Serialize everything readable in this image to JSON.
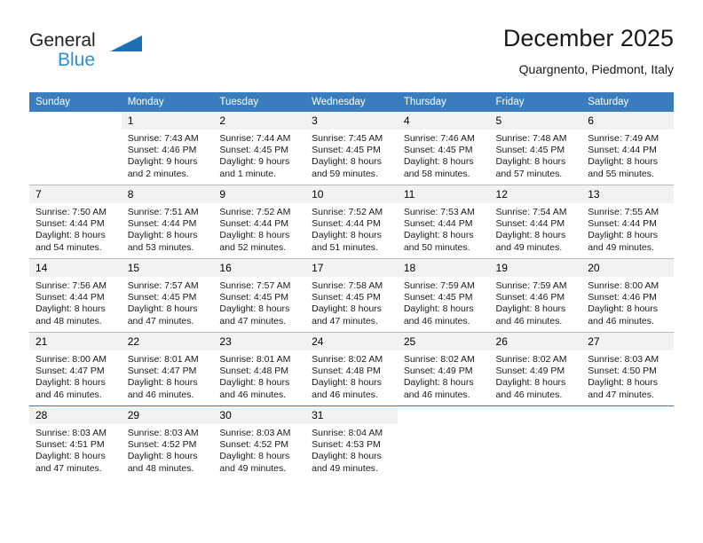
{
  "brand": {
    "name_part1": "General",
    "name_part2": "Blue",
    "colors": {
      "dark": "#231f20",
      "blue": "#2b8fd4",
      "triangle": "#1f6fb4"
    }
  },
  "header": {
    "title": "December 2025",
    "subtitle": "Quargnento, Piedmont, Italy"
  },
  "theme": {
    "header_row_bg": "#3a7dbf",
    "header_row_text": "#ffffff",
    "daynum_bg": "#f2f2f2",
    "grid_line": "#b9b9b9"
  },
  "weekdays": [
    "Sunday",
    "Monday",
    "Tuesday",
    "Wednesday",
    "Thursday",
    "Friday",
    "Saturday"
  ],
  "weeks": [
    [
      {
        "day": "",
        "blank": true,
        "sunrise": "",
        "sunset": "",
        "daylight1": "",
        "daylight2": ""
      },
      {
        "day": "1",
        "sunrise": "Sunrise: 7:43 AM",
        "sunset": "Sunset: 4:46 PM",
        "daylight1": "Daylight: 9 hours",
        "daylight2": "and 2 minutes."
      },
      {
        "day": "2",
        "sunrise": "Sunrise: 7:44 AM",
        "sunset": "Sunset: 4:45 PM",
        "daylight1": "Daylight: 9 hours",
        "daylight2": "and 1 minute."
      },
      {
        "day": "3",
        "sunrise": "Sunrise: 7:45 AM",
        "sunset": "Sunset: 4:45 PM",
        "daylight1": "Daylight: 8 hours",
        "daylight2": "and 59 minutes."
      },
      {
        "day": "4",
        "sunrise": "Sunrise: 7:46 AM",
        "sunset": "Sunset: 4:45 PM",
        "daylight1": "Daylight: 8 hours",
        "daylight2": "and 58 minutes."
      },
      {
        "day": "5",
        "sunrise": "Sunrise: 7:48 AM",
        "sunset": "Sunset: 4:45 PM",
        "daylight1": "Daylight: 8 hours",
        "daylight2": "and 57 minutes."
      },
      {
        "day": "6",
        "sunrise": "Sunrise: 7:49 AM",
        "sunset": "Sunset: 4:44 PM",
        "daylight1": "Daylight: 8 hours",
        "daylight2": "and 55 minutes."
      }
    ],
    [
      {
        "day": "7",
        "sunrise": "Sunrise: 7:50 AM",
        "sunset": "Sunset: 4:44 PM",
        "daylight1": "Daylight: 8 hours",
        "daylight2": "and 54 minutes."
      },
      {
        "day": "8",
        "sunrise": "Sunrise: 7:51 AM",
        "sunset": "Sunset: 4:44 PM",
        "daylight1": "Daylight: 8 hours",
        "daylight2": "and 53 minutes."
      },
      {
        "day": "9",
        "sunrise": "Sunrise: 7:52 AM",
        "sunset": "Sunset: 4:44 PM",
        "daylight1": "Daylight: 8 hours",
        "daylight2": "and 52 minutes."
      },
      {
        "day": "10",
        "sunrise": "Sunrise: 7:52 AM",
        "sunset": "Sunset: 4:44 PM",
        "daylight1": "Daylight: 8 hours",
        "daylight2": "and 51 minutes."
      },
      {
        "day": "11",
        "sunrise": "Sunrise: 7:53 AM",
        "sunset": "Sunset: 4:44 PM",
        "daylight1": "Daylight: 8 hours",
        "daylight2": "and 50 minutes."
      },
      {
        "day": "12",
        "sunrise": "Sunrise: 7:54 AM",
        "sunset": "Sunset: 4:44 PM",
        "daylight1": "Daylight: 8 hours",
        "daylight2": "and 49 minutes."
      },
      {
        "day": "13",
        "sunrise": "Sunrise: 7:55 AM",
        "sunset": "Sunset: 4:44 PM",
        "daylight1": "Daylight: 8 hours",
        "daylight2": "and 49 minutes."
      }
    ],
    [
      {
        "day": "14",
        "sunrise": "Sunrise: 7:56 AM",
        "sunset": "Sunset: 4:44 PM",
        "daylight1": "Daylight: 8 hours",
        "daylight2": "and 48 minutes."
      },
      {
        "day": "15",
        "sunrise": "Sunrise: 7:57 AM",
        "sunset": "Sunset: 4:45 PM",
        "daylight1": "Daylight: 8 hours",
        "daylight2": "and 47 minutes."
      },
      {
        "day": "16",
        "sunrise": "Sunrise: 7:57 AM",
        "sunset": "Sunset: 4:45 PM",
        "daylight1": "Daylight: 8 hours",
        "daylight2": "and 47 minutes."
      },
      {
        "day": "17",
        "sunrise": "Sunrise: 7:58 AM",
        "sunset": "Sunset: 4:45 PM",
        "daylight1": "Daylight: 8 hours",
        "daylight2": "and 47 minutes."
      },
      {
        "day": "18",
        "sunrise": "Sunrise: 7:59 AM",
        "sunset": "Sunset: 4:45 PM",
        "daylight1": "Daylight: 8 hours",
        "daylight2": "and 46 minutes."
      },
      {
        "day": "19",
        "sunrise": "Sunrise: 7:59 AM",
        "sunset": "Sunset: 4:46 PM",
        "daylight1": "Daylight: 8 hours",
        "daylight2": "and 46 minutes."
      },
      {
        "day": "20",
        "sunrise": "Sunrise: 8:00 AM",
        "sunset": "Sunset: 4:46 PM",
        "daylight1": "Daylight: 8 hours",
        "daylight2": "and 46 minutes."
      }
    ],
    [
      {
        "day": "21",
        "sunrise": "Sunrise: 8:00 AM",
        "sunset": "Sunset: 4:47 PM",
        "daylight1": "Daylight: 8 hours",
        "daylight2": "and 46 minutes."
      },
      {
        "day": "22",
        "sunrise": "Sunrise: 8:01 AM",
        "sunset": "Sunset: 4:47 PM",
        "daylight1": "Daylight: 8 hours",
        "daylight2": "and 46 minutes."
      },
      {
        "day": "23",
        "sunrise": "Sunrise: 8:01 AM",
        "sunset": "Sunset: 4:48 PM",
        "daylight1": "Daylight: 8 hours",
        "daylight2": "and 46 minutes."
      },
      {
        "day": "24",
        "sunrise": "Sunrise: 8:02 AM",
        "sunset": "Sunset: 4:48 PM",
        "daylight1": "Daylight: 8 hours",
        "daylight2": "and 46 minutes."
      },
      {
        "day": "25",
        "sunrise": "Sunrise: 8:02 AM",
        "sunset": "Sunset: 4:49 PM",
        "daylight1": "Daylight: 8 hours",
        "daylight2": "and 46 minutes."
      },
      {
        "day": "26",
        "sunrise": "Sunrise: 8:02 AM",
        "sunset": "Sunset: 4:49 PM",
        "daylight1": "Daylight: 8 hours",
        "daylight2": "and 46 minutes."
      },
      {
        "day": "27",
        "sunrise": "Sunrise: 8:03 AM",
        "sunset": "Sunset: 4:50 PM",
        "daylight1": "Daylight: 8 hours",
        "daylight2": "and 47 minutes."
      }
    ],
    [
      {
        "day": "28",
        "sunrise": "Sunrise: 8:03 AM",
        "sunset": "Sunset: 4:51 PM",
        "daylight1": "Daylight: 8 hours",
        "daylight2": "and 47 minutes."
      },
      {
        "day": "29",
        "sunrise": "Sunrise: 8:03 AM",
        "sunset": "Sunset: 4:52 PM",
        "daylight1": "Daylight: 8 hours",
        "daylight2": "and 48 minutes."
      },
      {
        "day": "30",
        "sunrise": "Sunrise: 8:03 AM",
        "sunset": "Sunset: 4:52 PM",
        "daylight1": "Daylight: 8 hours",
        "daylight2": "and 49 minutes."
      },
      {
        "day": "31",
        "sunrise": "Sunrise: 8:04 AM",
        "sunset": "Sunset: 4:53 PM",
        "daylight1": "Daylight: 8 hours",
        "daylight2": "and 49 minutes."
      },
      {
        "day": "",
        "blank": true,
        "sunrise": "",
        "sunset": "",
        "daylight1": "",
        "daylight2": ""
      },
      {
        "day": "",
        "blank": true,
        "sunrise": "",
        "sunset": "",
        "daylight1": "",
        "daylight2": ""
      },
      {
        "day": "",
        "blank": true,
        "sunrise": "",
        "sunset": "",
        "daylight1": "",
        "daylight2": ""
      }
    ]
  ]
}
